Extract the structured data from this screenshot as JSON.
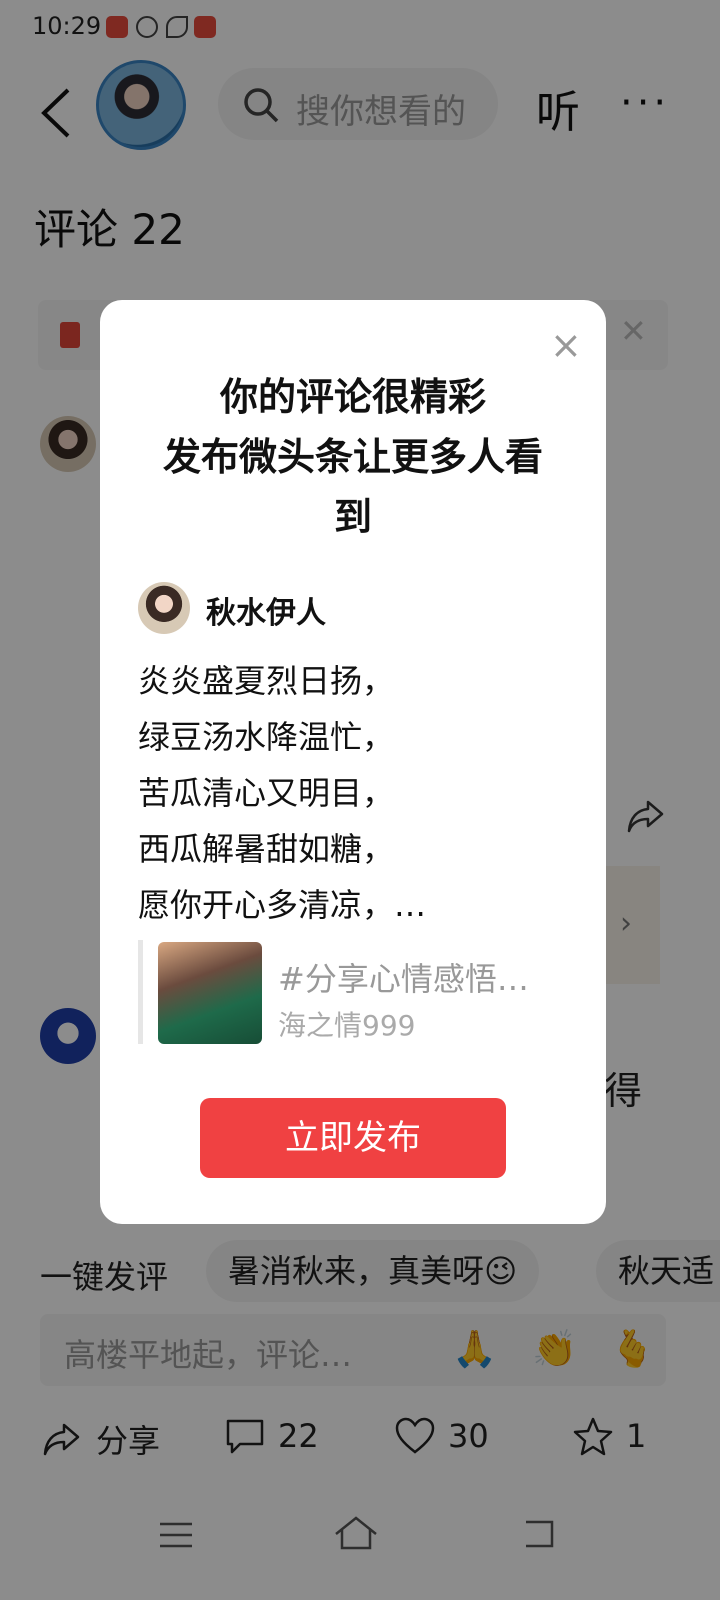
{
  "status_bar": {
    "time": "10:29"
  },
  "nav": {
    "search_placeholder": "搜你想看的",
    "listen_label": "听",
    "more_label": "···"
  },
  "page": {
    "comments_title": "评论 22",
    "side_text": "得"
  },
  "modal": {
    "title_line1": "你的评论很精彩",
    "title_line2": "发布微头条让更多人看",
    "title_line3": "到",
    "close_label": "×",
    "author_name": "秋水伊人",
    "poem_lines": [
      "炎炎盛夏烈日扬，",
      "绿豆汤水降温忙，",
      "苦瓜清心又明目，",
      "西瓜解暑甜如糖，",
      "愿你开心多清凉，…"
    ],
    "tag_text": "#分享心情感悟…",
    "tag_user": "海之情999",
    "publish_button": "立即发布"
  },
  "quick_reply": {
    "label": "一键发评",
    "chips": [
      "暑消秋来，真美呀😉",
      "秋天适"
    ]
  },
  "comment_input": {
    "placeholder": "高楼平地起，评论…",
    "emojis": [
      "🙏",
      "👏",
      "🫰"
    ]
  },
  "bottom_bar": {
    "share_label": "分享",
    "comment_count": "22",
    "like_count": "30",
    "favorite_count": "1"
  },
  "colors": {
    "accent": "#f04142",
    "overlay": "rgba(0,0,0,0.45)"
  }
}
